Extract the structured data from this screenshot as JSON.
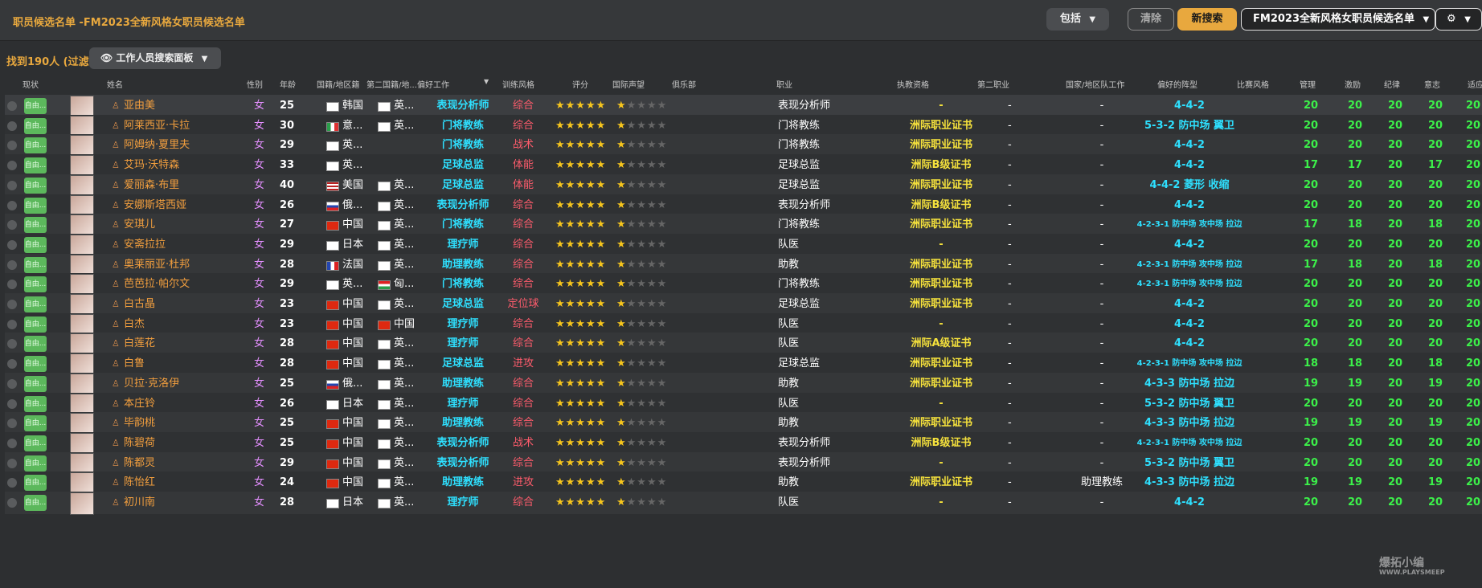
{
  "window": {
    "title": "职员候选名单 -FM2023全新风格女职员候选名单"
  },
  "toolbar": {
    "include_label": "包括",
    "clear_label": "清除",
    "new_search_label": "新搜索",
    "list_label": "FM2023全新风格女职员候选名单",
    "settings_icon": "gear-icon"
  },
  "subbar": {
    "result_count": "找到190人 (过滤)",
    "panel_label": "工作人员搜索面板"
  },
  "columns": [
    "现状",
    "姓名",
    "性别",
    "年龄",
    "国籍/地区籍",
    "第二国籍/地...",
    "偏好工作",
    "训练风格",
    "评分",
    "国际声望",
    "俱乐部",
    "职业",
    "执教资格",
    "第二职业",
    "国家/地区队工作",
    "偏好的阵型",
    "比赛风格",
    "管理",
    "激励",
    "纪律",
    "意志",
    "适应"
  ],
  "colors": {
    "accent": "#e8a83e",
    "job": "#2ee0ff",
    "attr": "#3cf04a",
    "license": "#f5e13c"
  },
  "rows": [
    {
      "status": "自由...",
      "name": "亚由美",
      "sex": "女",
      "age": "25",
      "nat": "韩国",
      "nat2": "英...",
      "job": "表现分析师",
      "style": "综合",
      "stars": "★★★★★",
      "rep": "★",
      "role": "表现分析师",
      "license": "-",
      "sec": "-",
      "nt": "-",
      "form": "4-4-2",
      "a": [
        "20",
        "20",
        "20",
        "20",
        "20"
      ]
    },
    {
      "status": "自由...",
      "name": "阿莱西亚·卡拉",
      "sex": "女",
      "age": "30",
      "nat": "意...",
      "nat2": "英...",
      "job": "门将教练",
      "style": "综合",
      "stars": "★★★★★",
      "rep": "★",
      "role": "门将教练",
      "license": "洲际职业证书",
      "sec": "-",
      "nt": "-",
      "form": "5-3-2 防中场 翼卫",
      "a": [
        "20",
        "20",
        "20",
        "20",
        "20"
      ]
    },
    {
      "status": "自由...",
      "name": "阿姆纳·夏里夫",
      "sex": "女",
      "age": "29",
      "nat": "英...",
      "nat2": "",
      "job": "门将教练",
      "style": "战术",
      "stars": "★★★★★",
      "rep": "★",
      "role": "门将教练",
      "license": "洲际职业证书",
      "sec": "-",
      "nt": "-",
      "form": "4-4-2",
      "a": [
        "20",
        "20",
        "20",
        "20",
        "20"
      ]
    },
    {
      "status": "自由...",
      "name": "艾玛·沃特森",
      "sex": "女",
      "age": "33",
      "nat": "英...",
      "nat2": "",
      "job": "足球总监",
      "style": "体能",
      "stars": "★★★★★",
      "rep": "★",
      "role": "足球总监",
      "license": "洲际B级证书",
      "sec": "-",
      "nt": "-",
      "form": "4-4-2",
      "a": [
        "17",
        "17",
        "20",
        "17",
        "20"
      ]
    },
    {
      "status": "自由...",
      "name": "爱丽森·布里",
      "sex": "女",
      "age": "40",
      "nat": "美国",
      "nat2": "英...",
      "job": "足球总监",
      "style": "体能",
      "stars": "★★★★★",
      "rep": "★",
      "role": "足球总监",
      "license": "洲际职业证书",
      "sec": "-",
      "nt": "-",
      "form": "4-4-2 菱形 收缩",
      "a": [
        "20",
        "20",
        "20",
        "20",
        "20"
      ]
    },
    {
      "status": "自由...",
      "name": "安娜斯塔西娅",
      "sex": "女",
      "age": "26",
      "nat": "俄...",
      "nat2": "英...",
      "job": "表现分析师",
      "style": "综合",
      "stars": "★★★★★",
      "rep": "★",
      "role": "表现分析师",
      "license": "洲际B级证书",
      "sec": "-",
      "nt": "-",
      "form": "4-4-2",
      "a": [
        "20",
        "20",
        "20",
        "20",
        "20"
      ]
    },
    {
      "status": "自由...",
      "name": "安琪儿",
      "sex": "女",
      "age": "27",
      "nat": "中国",
      "nat2": "英...",
      "job": "门将教练",
      "style": "综合",
      "stars": "★★★★★",
      "rep": "★",
      "role": "门将教练",
      "license": "洲际职业证书",
      "sec": "-",
      "nt": "-",
      "form": "4-2-3-1 防中场 攻中场 拉边",
      "a": [
        "17",
        "18",
        "20",
        "18",
        "20"
      ]
    },
    {
      "status": "自由...",
      "name": "安斋拉拉",
      "sex": "女",
      "age": "29",
      "nat": "日本",
      "nat2": "英...",
      "job": "理疗师",
      "style": "综合",
      "stars": "★★★★★",
      "rep": "★",
      "role": "队医",
      "license": "-",
      "sec": "-",
      "nt": "-",
      "form": "4-4-2",
      "a": [
        "20",
        "20",
        "20",
        "20",
        "20"
      ]
    },
    {
      "status": "自由...",
      "name": "奥莱丽亚·杜邦",
      "sex": "女",
      "age": "28",
      "nat": "法国",
      "nat2": "英...",
      "job": "助理教练",
      "style": "综合",
      "stars": "★★★★★",
      "rep": "★",
      "role": "助教",
      "license": "洲际职业证书",
      "sec": "-",
      "nt": "-",
      "form": "4-2-3-1 防中场 攻中场 拉边",
      "a": [
        "17",
        "18",
        "20",
        "18",
        "20"
      ]
    },
    {
      "status": "自由...",
      "name": "芭芭拉·帕尔文",
      "sex": "女",
      "age": "29",
      "nat": "英...",
      "nat2": "匈...",
      "job": "门将教练",
      "style": "综合",
      "stars": "★★★★★",
      "rep": "★",
      "role": "门将教练",
      "license": "洲际职业证书",
      "sec": "-",
      "nt": "-",
      "form": "4-2-3-1 防中场 攻中场 拉边",
      "a": [
        "20",
        "20",
        "20",
        "20",
        "20"
      ]
    },
    {
      "status": "自由...",
      "name": "白古晶",
      "sex": "女",
      "age": "23",
      "nat": "中国",
      "nat2": "英...",
      "job": "足球总监",
      "style": "定位球",
      "stars": "★★★★★",
      "rep": "★",
      "role": "足球总监",
      "license": "洲际职业证书",
      "sec": "-",
      "nt": "-",
      "form": "4-4-2",
      "a": [
        "20",
        "20",
        "20",
        "20",
        "20"
      ]
    },
    {
      "status": "自由...",
      "name": "白杰",
      "sex": "女",
      "age": "23",
      "nat": "中国",
      "nat2": "中国",
      "job": "理疗师",
      "style": "综合",
      "stars": "★★★★★",
      "rep": "★",
      "role": "队医",
      "license": "-",
      "sec": "-",
      "nt": "-",
      "form": "4-4-2",
      "a": [
        "20",
        "20",
        "20",
        "20",
        "20"
      ]
    },
    {
      "status": "自由...",
      "name": "白莲花",
      "sex": "女",
      "age": "28",
      "nat": "中国",
      "nat2": "英...",
      "job": "理疗师",
      "style": "综合",
      "stars": "★★★★★",
      "rep": "★",
      "role": "队医",
      "license": "洲际A级证书",
      "sec": "-",
      "nt": "-",
      "form": "4-4-2",
      "a": [
        "20",
        "20",
        "20",
        "20",
        "20"
      ]
    },
    {
      "status": "自由...",
      "name": "白鲁",
      "sex": "女",
      "age": "28",
      "nat": "中国",
      "nat2": "英...",
      "job": "足球总监",
      "style": "进攻",
      "stars": "★★★★★",
      "rep": "★",
      "role": "足球总监",
      "license": "洲际职业证书",
      "sec": "-",
      "nt": "-",
      "form": "4-2-3-1 防中场 攻中场 拉边",
      "a": [
        "18",
        "18",
        "20",
        "18",
        "20"
      ]
    },
    {
      "status": "自由...",
      "name": "贝拉·克洛伊",
      "sex": "女",
      "age": "25",
      "nat": "俄...",
      "nat2": "英...",
      "job": "助理教练",
      "style": "综合",
      "stars": "★★★★★",
      "rep": "★",
      "role": "助教",
      "license": "洲际职业证书",
      "sec": "-",
      "nt": "-",
      "form": "4-3-3 防中场 拉边",
      "a": [
        "19",
        "19",
        "20",
        "19",
        "20"
      ]
    },
    {
      "status": "自由...",
      "name": "本庄铃",
      "sex": "女",
      "age": "26",
      "nat": "日本",
      "nat2": "英...",
      "job": "理疗师",
      "style": "综合",
      "stars": "★★★★★",
      "rep": "★",
      "role": "队医",
      "license": "-",
      "sec": "-",
      "nt": "-",
      "form": "5-3-2 防中场 翼卫",
      "a": [
        "20",
        "20",
        "20",
        "20",
        "20"
      ]
    },
    {
      "status": "自由...",
      "name": "毕韵桃",
      "sex": "女",
      "age": "25",
      "nat": "中国",
      "nat2": "英...",
      "job": "助理教练",
      "style": "综合",
      "stars": "★★★★★",
      "rep": "★",
      "role": "助教",
      "license": "洲际职业证书",
      "sec": "-",
      "nt": "-",
      "form": "4-3-3 防中场 拉边",
      "a": [
        "19",
        "19",
        "20",
        "19",
        "20"
      ]
    },
    {
      "status": "自由...",
      "name": "陈碧荷",
      "sex": "女",
      "age": "25",
      "nat": "中国",
      "nat2": "英...",
      "job": "表现分析师",
      "style": "战术",
      "stars": "★★★★★",
      "rep": "★",
      "role": "表现分析师",
      "license": "洲际B级证书",
      "sec": "-",
      "nt": "-",
      "form": "4-2-3-1 防中场 攻中场 拉边",
      "a": [
        "20",
        "20",
        "20",
        "20",
        "20"
      ]
    },
    {
      "status": "自由...",
      "name": "陈都灵",
      "sex": "女",
      "age": "29",
      "nat": "中国",
      "nat2": "英...",
      "job": "表现分析师",
      "style": "综合",
      "stars": "★★★★★",
      "rep": "★",
      "role": "表现分析师",
      "license": "-",
      "sec": "-",
      "nt": "-",
      "form": "5-3-2 防中场 翼卫",
      "a": [
        "20",
        "20",
        "20",
        "20",
        "20"
      ]
    },
    {
      "status": "自由...",
      "name": "陈怡红",
      "sex": "女",
      "age": "24",
      "nat": "中国",
      "nat2": "英...",
      "job": "助理教练",
      "style": "进攻",
      "stars": "★★★★★",
      "rep": "★",
      "role": "助教",
      "license": "洲际职业证书",
      "sec": "-",
      "nt": "助理教练",
      "form": "4-3-3 防中场 拉边",
      "a": [
        "19",
        "19",
        "20",
        "19",
        "20"
      ]
    },
    {
      "status": "自由...",
      "name": "初川南",
      "sex": "女",
      "age": "28",
      "nat": "日本",
      "nat2": "英...",
      "job": "理疗师",
      "style": "综合",
      "stars": "★★★★★",
      "rep": "★",
      "role": "队医",
      "license": "-",
      "sec": "-",
      "nt": "-",
      "form": "4-4-2",
      "a": [
        "20",
        "20",
        "20",
        "20",
        "20"
      ]
    }
  ],
  "watermark": {
    "text": "爆拓小编",
    "sub": "WWW.PLAYSMEEP"
  }
}
